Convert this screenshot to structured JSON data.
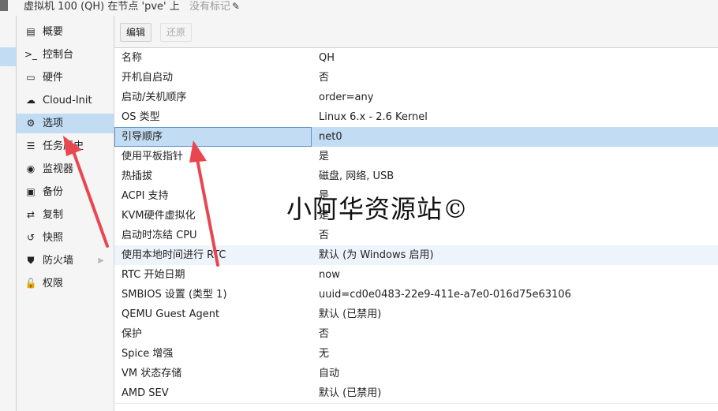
{
  "window": {
    "title": "虚拟机 100 (QH) 在节点 'pve' 上",
    "tags_placeholder": "没有标记",
    "pencil_icon": "pencil-icon"
  },
  "sidebar": {
    "items": [
      {
        "icon": "book-icon",
        "glyph": "▤",
        "label": "概要"
      },
      {
        "icon": "terminal-icon",
        "glyph": ">_",
        "label": "控制台"
      },
      {
        "icon": "desktop-icon",
        "glyph": "▭",
        "label": "硬件"
      },
      {
        "icon": "cloud-icon",
        "glyph": "☁",
        "label": "Cloud-Init"
      },
      {
        "icon": "gear-icon",
        "glyph": "⚙",
        "label": "选项"
      },
      {
        "icon": "list-icon",
        "glyph": "☰",
        "label": "任务历史"
      },
      {
        "icon": "eye-icon",
        "glyph": "◉",
        "label": "监视器"
      },
      {
        "icon": "floppy-icon",
        "glyph": "▣",
        "label": "备份"
      },
      {
        "icon": "retweet-icon",
        "glyph": "⇄",
        "label": "复制"
      },
      {
        "icon": "history-icon",
        "glyph": "↺",
        "label": "快照"
      },
      {
        "icon": "shield-icon",
        "glyph": "⛊",
        "label": "防火墙"
      },
      {
        "icon": "unlock-icon",
        "glyph": "🔓",
        "label": "权限"
      }
    ],
    "active_index": 4
  },
  "toolbar": {
    "edit_label": "编辑",
    "revert_label": "还原"
  },
  "options": [
    {
      "key": "名称",
      "value": "QH"
    },
    {
      "key": "开机自启动",
      "value": "否"
    },
    {
      "key": "启动/关机顺序",
      "value": "order=any"
    },
    {
      "key": "OS 类型",
      "value": "Linux 6.x - 2.6 Kernel"
    },
    {
      "key": "引导顺序",
      "value": "net0"
    },
    {
      "key": "使用平板指针",
      "value": "是"
    },
    {
      "key": "热插拔",
      "value": "磁盘, 网络, USB"
    },
    {
      "key": "ACPI 支持",
      "value": "是"
    },
    {
      "key": "KVM硬件虚拟化",
      "value": "是"
    },
    {
      "key": "启动时冻结 CPU",
      "value": "否"
    },
    {
      "key": "使用本地时间进行 RTC",
      "value": "默认 (为 Windows 启用)"
    },
    {
      "key": "RTC 开始日期",
      "value": "now"
    },
    {
      "key": "SMBIOS 设置 (类型 1)",
      "value": "uuid=cd0e0483-22e9-411e-a7e0-016d75e63106"
    },
    {
      "key": "QEMU Guest Agent",
      "value": "默认 (已禁用)"
    },
    {
      "key": "保护",
      "value": "否"
    },
    {
      "key": "Spice 增强",
      "value": "无"
    },
    {
      "key": "VM 状态存储",
      "value": "自动"
    },
    {
      "key": "AMD SEV",
      "value": "默认 (已禁用)"
    }
  ],
  "selected_row": 4,
  "hovered_row": 10,
  "watermark": "小阿华资源站©",
  "colors": {
    "selection": "#c2dcf3",
    "arrow": "#e8474f"
  }
}
